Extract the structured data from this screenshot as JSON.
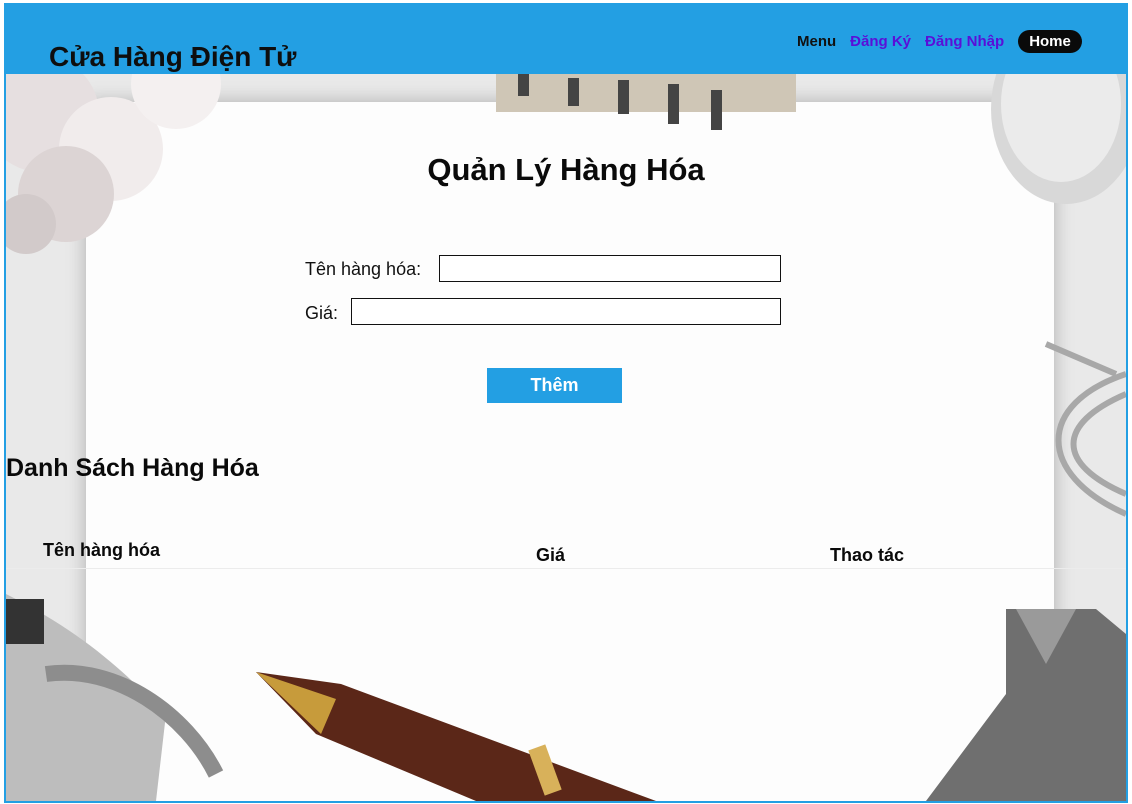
{
  "header": {
    "brand": "Cửa Hàng Điện Tử",
    "nav": {
      "menu": "Menu",
      "register": "Đăng Ký",
      "login": "Đăng Nhập",
      "home": "Home"
    }
  },
  "main": {
    "title": "Quản Lý Hàng Hóa",
    "form": {
      "name_label": "Tên hàng hóa:",
      "name_value": "",
      "price_label": "Giá:",
      "price_value": "",
      "submit_label": "Thêm"
    },
    "list": {
      "title": "Danh Sách Hàng Hóa",
      "columns": [
        "Tên hàng hóa",
        "Giá",
        "Thao tác"
      ]
    }
  },
  "colors": {
    "accent": "#239fe3",
    "nav_link": "#5a0fd8",
    "home_pill": "#0a0a0a"
  }
}
